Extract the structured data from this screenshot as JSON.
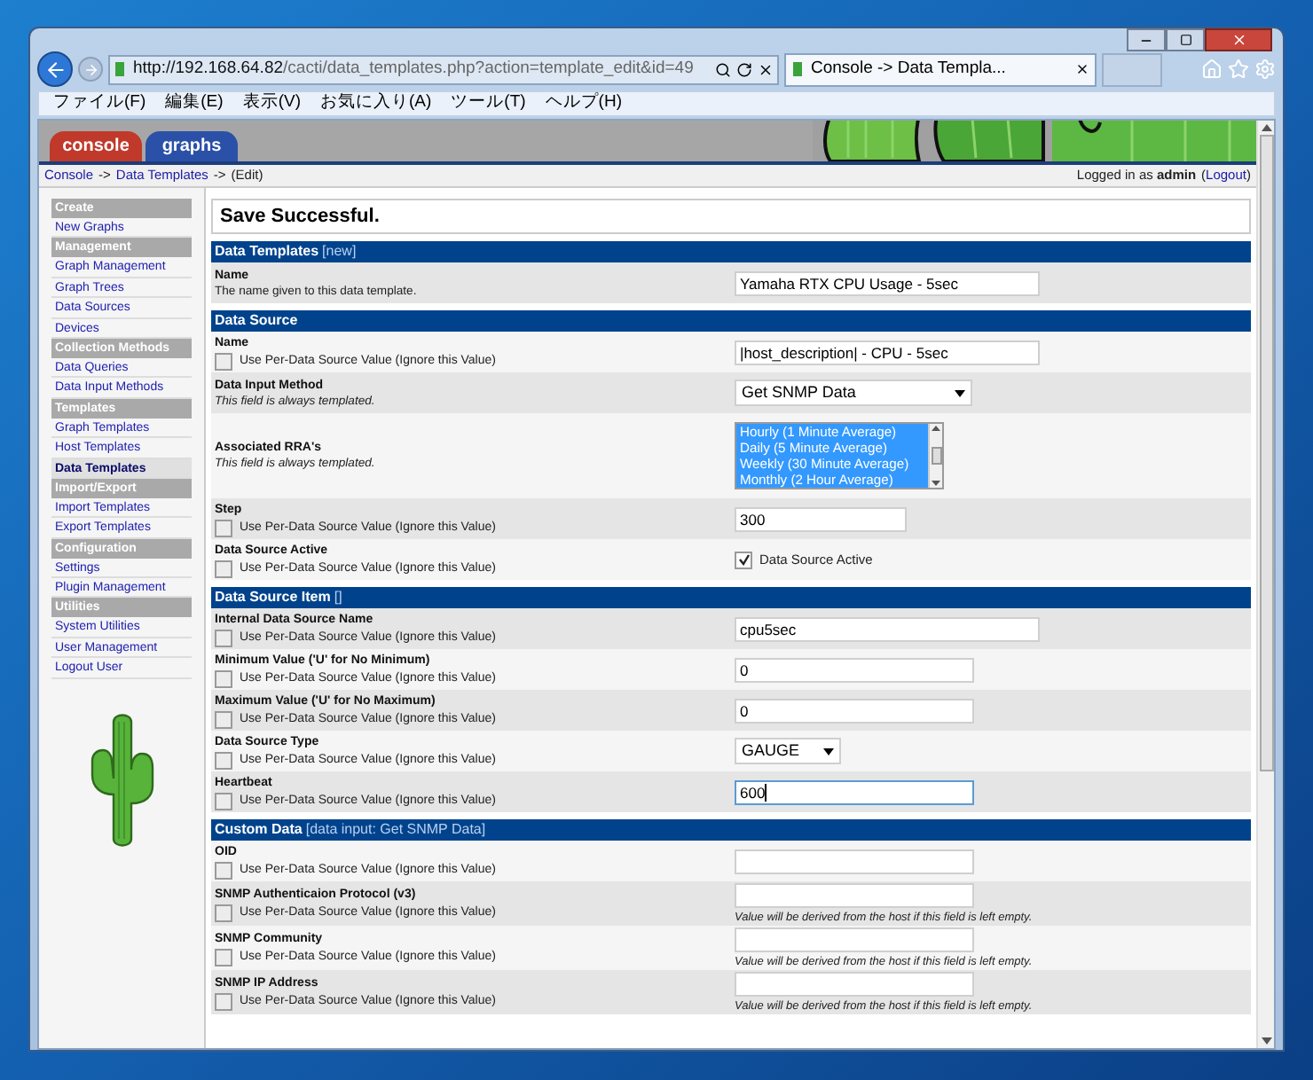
{
  "browser": {
    "url_host": "http://192.168.64.82",
    "url_path": "/cacti/data_templates.php?action=template_edit&id=49",
    "tab_title": "Console -> Data Templa...",
    "menu": [
      "ファイル(F)",
      "編集(E)",
      "表示(V)",
      "お気に入り(A)",
      "ツール(T)",
      "ヘルプ(H)"
    ]
  },
  "app_tabs": [
    {
      "label": "console",
      "selected": true
    },
    {
      "label": "graphs",
      "selected": false
    }
  ],
  "breadcrumb": [
    {
      "kind": "link",
      "text": "Console"
    },
    {
      "kind": "text",
      "text": "->"
    },
    {
      "kind": "link",
      "text": "Data Templates"
    },
    {
      "kind": "text",
      "text": "->"
    },
    {
      "kind": "text",
      "text": "(Edit)"
    }
  ],
  "login": [
    {
      "kind": "text",
      "text": "Logged in as **admin**"
    },
    {
      "kind": "text",
      "text": "("
    },
    {
      "kind": "link",
      "text": "Logout"
    },
    {
      "kind": "text",
      "text": ")"
    }
  ],
  "sidebar": [
    {
      "title": "Create",
      "items": [
        {
          "label": "New Graphs",
          "selected": false
        }
      ]
    },
    {
      "title": "Management",
      "items": [
        {
          "label": "Graph Management",
          "selected": false
        },
        {
          "label": "Graph Trees",
          "selected": false
        },
        {
          "label": "Data Sources",
          "selected": false
        },
        {
          "label": "Devices",
          "selected": false
        }
      ]
    },
    {
      "title": "Collection Methods",
      "items": [
        {
          "label": "Data Queries",
          "selected": false
        },
        {
          "label": "Data Input Methods",
          "selected": false
        }
      ]
    },
    {
      "title": "Templates",
      "items": [
        {
          "label": "Graph Templates",
          "selected": false
        },
        {
          "label": "Host Templates",
          "selected": false
        },
        {
          "label": "Data Templates",
          "selected": true
        }
      ]
    },
    {
      "title": "Import/Export",
      "items": [
        {
          "label": "Import Templates",
          "selected": false
        },
        {
          "label": "Export Templates",
          "selected": false
        }
      ]
    },
    {
      "title": "Configuration",
      "items": [
        {
          "label": "Settings",
          "selected": false
        },
        {
          "label": "Plugin Management",
          "selected": false
        }
      ]
    },
    {
      "title": "Utilities",
      "items": [
        {
          "label": "System Utilities",
          "selected": false
        },
        {
          "label": "User Management",
          "selected": false
        },
        {
          "label": "Logout User",
          "selected": false
        }
      ]
    }
  ],
  "message": "Save Successful.",
  "sections": [
    {
      "title": "Data Templates",
      "note": "[new]",
      "rows": [
        {
          "label": "Name",
          "description": "The name given to this data template.",
          "italic": false,
          "kind": "text",
          "value": "Yamaha RTX CPU Usage - 5sec"
        }
      ]
    },
    {
      "title": "Data Source",
      "rows": [
        {
          "label": "Name",
          "per_ds": {
            "label": "Use Per-Data Source Value (Ignore this Value)",
            "checked": false
          },
          "kind": "text",
          "value": "|host_description| - CPU - 5sec"
        },
        {
          "label": "Data Input Method",
          "description": "This field is always templated.",
          "italic": true,
          "kind": "select",
          "value": "Get SNMP Data"
        },
        {
          "label": "Associated RRA's",
          "description": "This field is always templated.",
          "italic": true,
          "kind": "listbox",
          "options": [
            {
              "label": "Hourly (1 Minute Average)",
              "selected": true
            },
            {
              "label": "Daily (5 Minute Average)",
              "selected": true
            },
            {
              "label": "Weekly (30 Minute Average)",
              "selected": true
            },
            {
              "label": "Monthly (2 Hour Average)",
              "selected": true
            }
          ]
        },
        {
          "label": "Step",
          "per_ds": {
            "label": "Use Per-Data Source Value (Ignore this Value)",
            "checked": false
          },
          "kind": "short",
          "value": "300"
        },
        {
          "label": "Data Source Active",
          "per_ds": {
            "label": "Use Per-Data Source Value (Ignore this Value)",
            "checked": false
          },
          "kind": "checkbox",
          "checkbox_label": "Data Source Active",
          "checked": true
        }
      ]
    },
    {
      "title": "Data Source Item",
      "note": "[]",
      "rows": [
        {
          "label": "Internal Data Source Name",
          "per_ds": {
            "label": "Use Per-Data Source Value (Ignore this Value)",
            "checked": false
          },
          "kind": "text",
          "value": "cpu5sec"
        },
        {
          "label": "Minimum Value ('U' for No Minimum)",
          "per_ds": {
            "label": "Use Per-Data Source Value (Ignore this Value)",
            "checked": false
          },
          "kind": "medium",
          "value": "0"
        },
        {
          "label": "Maximum Value ('U' for No Maximum)",
          "per_ds": {
            "label": "Use Per-Data Source Value (Ignore this Value)",
            "checked": false
          },
          "kind": "medium",
          "value": "0"
        },
        {
          "label": "Data Source Type",
          "per_ds": {
            "label": "Use Per-Data Source Value (Ignore this Value)",
            "checked": false
          },
          "kind": "small-select",
          "value": "GAUGE"
        },
        {
          "label": "Heartbeat",
          "per_ds": {
            "label": "Use Per-Data Source Value (Ignore this Value)",
            "checked": false
          },
          "kind": "medium",
          "value": "600",
          "focused": true
        }
      ]
    },
    {
      "title": "Custom Data",
      "note": "[data input: Get SNMP Data]",
      "rows": [
        {
          "label": "OID",
          "per_ds": {
            "label": "Use Per-Data Source Value (Ignore this Value)",
            "checked": false
          },
          "kind": "medium"
        },
        {
          "label": "SNMP Authenticaion Protocol (v3)",
          "per_ds": {
            "label": "Use Per-Data Source Value (Ignore this Value)",
            "checked": false
          },
          "kind": "medium",
          "hint": "Value will be derived from the host if this field is left empty."
        },
        {
          "label": "SNMP Community",
          "per_ds": {
            "label": "Use Per-Data Source Value (Ignore this Value)",
            "checked": false
          },
          "kind": "medium",
          "hint": "Value will be derived from the host if this field is left empty."
        },
        {
          "label": "SNMP IP Address",
          "per_ds": {
            "label": "Use Per-Data Source Value (Ignore this Value)",
            "checked": false
          },
          "kind": "medium",
          "hint": "Value will be derived from the host if this field is left empty."
        }
      ]
    }
  ]
}
